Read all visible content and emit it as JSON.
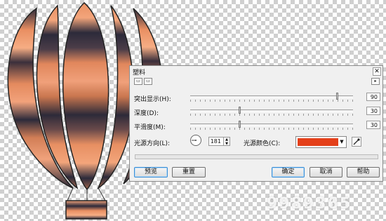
{
  "dialog": {
    "title": "塑料",
    "close_icon": "close-icon",
    "toolbar_buttons": [
      "preset-icon",
      "preset-save-icon"
    ],
    "more_icon": "expand-right-icon",
    "sliders": [
      {
        "label": "突出显示(H):",
        "value": "90",
        "level": 0.9
      },
      {
        "label": "深度(D):",
        "value": "30",
        "level": 0.3
      },
      {
        "label": "平滑度(M):",
        "value": "30",
        "level": 0.3
      }
    ],
    "direction": {
      "label": "光源方向(L):",
      "value": "181",
      "dial_icon": "direction-dial-icon"
    },
    "color": {
      "label": "光源颜色(C):",
      "value": "#e4401a",
      "eyedropper_icon": "eyedropper-icon"
    },
    "buttons": {
      "preview": "预览",
      "reset": "重置",
      "ok": "确定",
      "cancel": "取消",
      "help": "帮助"
    }
  },
  "watermark": "9989365"
}
